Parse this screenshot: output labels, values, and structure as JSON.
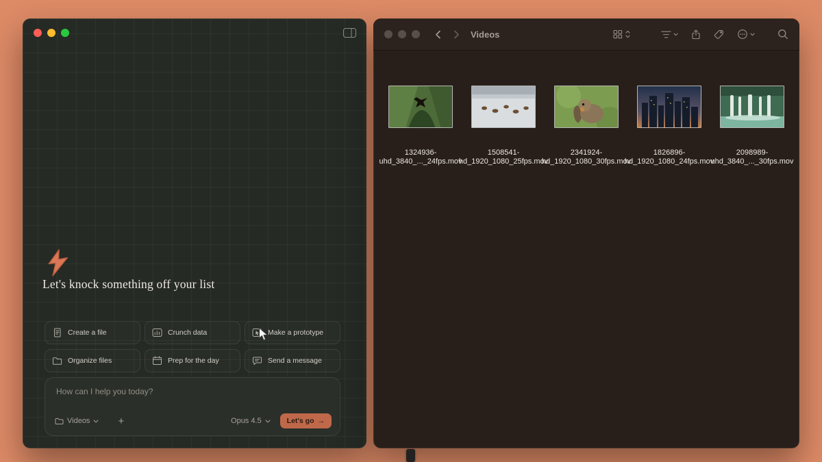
{
  "colors": {
    "desktop": "#dd8a66",
    "accent": "#c0684a",
    "bolt": "#d97757"
  },
  "cowork": {
    "heading": "Let's knock something off your list",
    "actions": [
      {
        "label": "Create a file",
        "icon": "file-icon"
      },
      {
        "label": "Crunch data",
        "icon": "chart-icon"
      },
      {
        "label": "Make a prototype",
        "icon": "prototype-icon"
      },
      {
        "label": "Organize files",
        "icon": "folder-icon"
      },
      {
        "label": "Prep for the day",
        "icon": "calendar-icon"
      },
      {
        "label": "Send a message",
        "icon": "message-icon"
      }
    ],
    "composer": {
      "placeholder": "How can I help you today?",
      "context_label": "Videos",
      "add_label": "+",
      "model_label": "Opus 4.5",
      "submit_label": "Let's go",
      "submit_arrow": "→"
    }
  },
  "finder": {
    "title": "Videos",
    "toolbar_icons": [
      "view-grid",
      "group-by",
      "share",
      "tag",
      "more",
      "search"
    ],
    "files": [
      {
        "line1": "1324936-",
        "line2": "uhd_3840_..._24fps.mov",
        "thumb": "forest-valley"
      },
      {
        "line1": "1508541-",
        "line2": "hd_1920_1080_25fps.mov",
        "thumb": "deer-in-snow"
      },
      {
        "line1": "2341924-",
        "line2": "hd_1920_1080_30fps.mov",
        "thumb": "squirrel"
      },
      {
        "line1": "1826896-",
        "line2": "hd_1920_1080_24fps.mov",
        "thumb": "city-dusk"
      },
      {
        "line1": "2098989-",
        "line2": "uhd_3840_..._30fps.mov",
        "thumb": "waterfalls"
      }
    ]
  }
}
